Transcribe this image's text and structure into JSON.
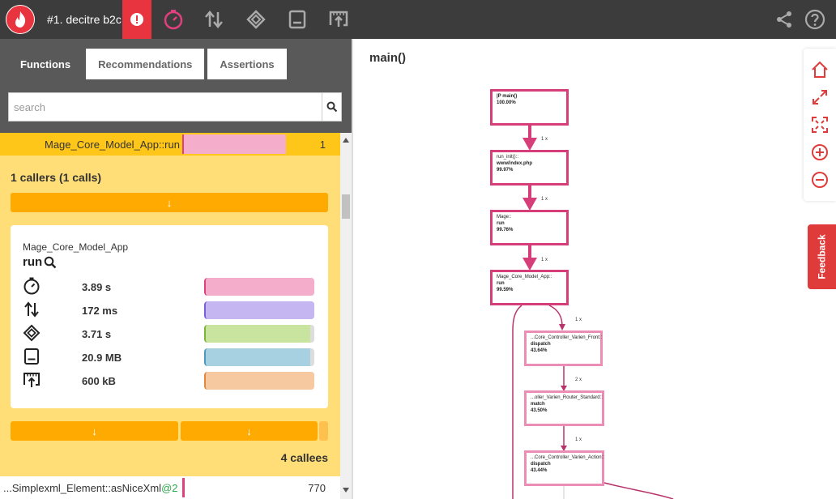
{
  "app": {
    "title": "#1. decitre b2c"
  },
  "icons": {
    "logo": "flame-icon",
    "alert": "alert-icon",
    "time": "stopwatch-icon",
    "io": "arrows-updown-icon",
    "cpu": "cpu-icon",
    "memory": "memory-icon",
    "network": "network-icon",
    "share": "share-icon",
    "help": "help-icon"
  },
  "tabs": [
    {
      "label": "Functions"
    },
    {
      "label": "Recommendations"
    },
    {
      "label": "Assertions"
    }
  ],
  "search": {
    "placeholder": "search",
    "value": ""
  },
  "selected_function": {
    "name": "Mage_Core_Model_App::run",
    "count": "1"
  },
  "callers": {
    "title": "1 callers (1 calls)",
    "arrow": "↓"
  },
  "card": {
    "class_name": "Mage_Core_Model_App",
    "method": "run",
    "metrics": [
      {
        "icon": "stopwatch-icon",
        "value": "3.89 s",
        "fill": 1.0,
        "color": "#f4aecb",
        "edge": "#e0407e"
      },
      {
        "icon": "arrows-updown-icon",
        "value": "172 ms",
        "fill": 1.0,
        "color": "#c5b5f0",
        "edge": "#7a5fd6"
      },
      {
        "icon": "cpu-icon",
        "value": "3.71 s",
        "fill": 0.96,
        "color": "#c8e49f",
        "edge": "#7ab33a"
      },
      {
        "icon": "memory-icon",
        "value": "20.9 MB",
        "fill": 0.96,
        "color": "#a7d0e0",
        "edge": "#4a9bbd"
      },
      {
        "icon": "network-icon",
        "value": "600 kB",
        "fill": 1.0,
        "color": "#f7c9a0",
        "edge": "#e08840"
      }
    ]
  },
  "callees": {
    "title": "4 callees",
    "arrow": "↓"
  },
  "callee_row": {
    "name": "...Simplexml_Element::asNiceXml",
    "tag": "@2",
    "count": "770"
  },
  "graph": {
    "title": "main()",
    "nodes": [
      {
        "line1": "|P main()",
        "line2": "",
        "pct": "100.00%"
      },
      {
        "line1": "run_init()::",
        "line2": "www/index.php",
        "pct": "99.97%"
      },
      {
        "line1": "Mage::",
        "line2": "run",
        "pct": "99.76%"
      },
      {
        "line1": "Mage_Core_Model_App::",
        "line2": "run",
        "pct": "99.59%"
      },
      {
        "line1": "...Core_Controller_Varien_Front::",
        "line2": "dispatch",
        "pct": "43.64%"
      },
      {
        "line1": "...oller_Varien_Router_Standard::",
        "line2": "match",
        "pct": "43.50%"
      },
      {
        "line1": "...Core_Controller_Varien_Action::",
        "line2": "dispatch",
        "pct": "43.44%"
      }
    ],
    "edges": [
      "1 x",
      "1 x",
      "1 x",
      "1 x",
      "2 x",
      "1 x"
    ]
  },
  "toolbar": [
    "home-icon",
    "expand-icon",
    "fit-icon",
    "zoom-in-icon",
    "zoom-out-icon"
  ],
  "feedback": {
    "label": "Feedback"
  },
  "colors": {
    "accent": "#ffc61a",
    "alert": "#e8343e",
    "node_border": "#d63e7a",
    "node_border_light": "#eb8db5"
  }
}
